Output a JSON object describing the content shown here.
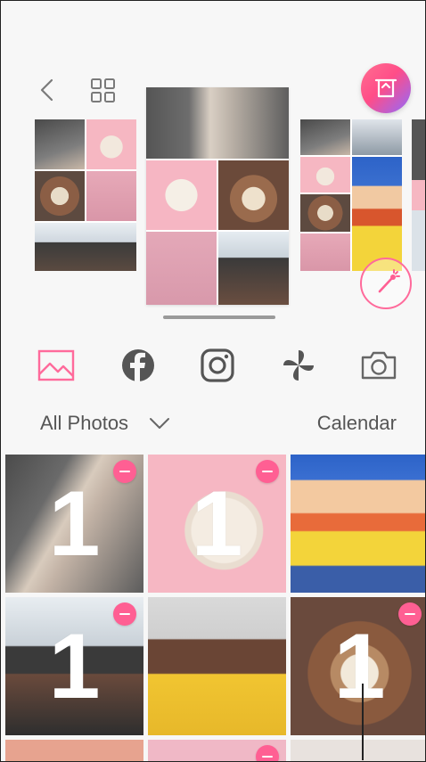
{
  "toolbar": {
    "back_icon": "chevron-left-icon",
    "grid_icon": "grid-icon",
    "action_icon": "print-tray-icon"
  },
  "sources": [
    {
      "name": "gallery",
      "icon": "image-icon",
      "active": true
    },
    {
      "name": "facebook",
      "icon": "facebook-icon",
      "active": false
    },
    {
      "name": "instagram",
      "icon": "instagram-icon",
      "active": false
    },
    {
      "name": "pinwheel",
      "icon": "pinwheel-icon",
      "active": false
    },
    {
      "name": "camera",
      "icon": "camera-icon",
      "active": false
    }
  ],
  "filter": {
    "album_label": "All Photos",
    "calendar_label": "Calendar"
  },
  "gallery": {
    "tiles": [
      {
        "count": "1",
        "selected": true
      },
      {
        "count": "1",
        "selected": true
      },
      {
        "count": "",
        "selected": false
      },
      {
        "count": "1",
        "selected": true
      },
      {
        "count": "",
        "selected": false
      },
      {
        "count": "1",
        "selected": true
      }
    ]
  },
  "colors": {
    "accent": "#ff5f93",
    "pink_bg": "#f7b6c3",
    "dark_bg": "#5a5a5a",
    "blue_bg": "#2d63c8"
  }
}
